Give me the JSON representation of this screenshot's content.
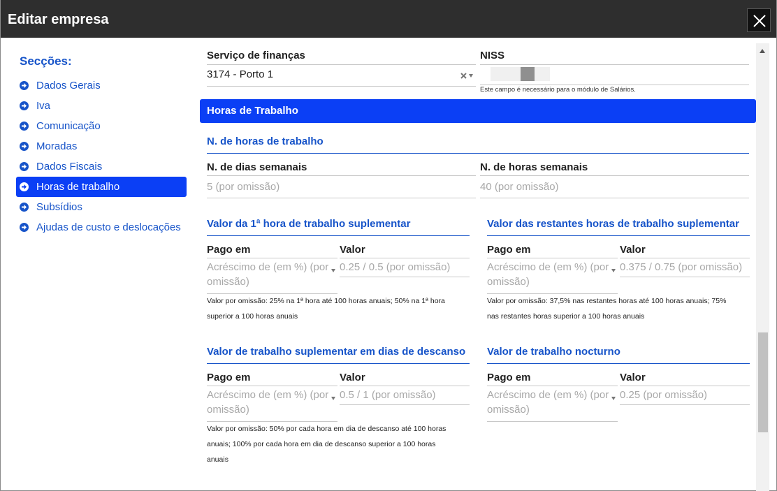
{
  "dialog": {
    "title": "Editar empresa"
  },
  "sidebar": {
    "title": "Secções:",
    "items": [
      {
        "label": "Dados Gerais"
      },
      {
        "label": "Iva"
      },
      {
        "label": "Comunicação"
      },
      {
        "label": "Moradas"
      },
      {
        "label": "Dados Fiscais"
      },
      {
        "label": "Horas de trabalho",
        "active": true
      },
      {
        "label": "Subsídios"
      },
      {
        "label": "Ajudas de custo e deslocações"
      }
    ]
  },
  "top_fields": {
    "servico_label": "Serviço de finanças",
    "servico_value": "3174 - Porto 1",
    "niss_label": "NISS",
    "niss_help": "Este campo é necessário para o módulo de Salários."
  },
  "horas": {
    "section_title": "Horas de Trabalho",
    "n_horas_title": "N. de horas de trabalho",
    "dias_label": "N. de dias semanais",
    "dias_placeholder": "5 (por omissão)",
    "horas_label": "N. de horas semanais",
    "horas_placeholder": "40 (por omissão)"
  },
  "blocks": [
    {
      "title": "Valor da 1ª hora de trabalho suplementar",
      "pago_label": "Pago em",
      "pago_placeholder_1": "Acréscimo de (em %) (por",
      "pago_placeholder_2": "omissão)",
      "valor_label": "Valor",
      "valor_placeholder": "0.25 / 0.5 (por omissão)",
      "help_1": "Valor por omissão: 25% na 1ª hora até 100 horas anuais; 50% na 1ª hora",
      "help_2": "superior a 100 horas anuais",
      "help_3": ""
    },
    {
      "title": "Valor das restantes horas de trabalho suplementar",
      "pago_label": "Pago em",
      "pago_placeholder_1": "Acréscimo de (em %) (por",
      "pago_placeholder_2": "omissão)",
      "valor_label": "Valor",
      "valor_placeholder": "0.375 / 0.75 (por omissão)",
      "help_1": "Valor por omissão: 37,5% nas restantes horas até 100 horas anuais; 75%",
      "help_2": "nas restantes horas superior a 100 horas anuais",
      "help_3": ""
    },
    {
      "title": "Valor de trabalho suplementar em dias de descanso",
      "pago_label": "Pago em",
      "pago_placeholder_1": "Acréscimo de (em %) (por",
      "pago_placeholder_2": "omissão)",
      "valor_label": "Valor",
      "valor_placeholder": "0.5 / 1 (por omissão)",
      "help_1": "Valor por omissão: 50% por cada hora em dia de descanso até 100 horas",
      "help_2": "anuais; 100% por cada hora em dia de descanso superior a 100 horas",
      "help_3": "anuais"
    },
    {
      "title": "Valor de trabalho nocturno",
      "pago_label": "Pago em",
      "pago_placeholder_1": "Acréscimo de (em %) (por",
      "pago_placeholder_2": "omissão)",
      "valor_label": "Valor",
      "valor_placeholder": "0.25 (por omissão)",
      "help_1": "",
      "help_2": "",
      "help_3": ""
    }
  ],
  "colors": {
    "accent": "#0b3ff5",
    "link": "#1754c9",
    "titlebar": "#2e2e2e"
  }
}
